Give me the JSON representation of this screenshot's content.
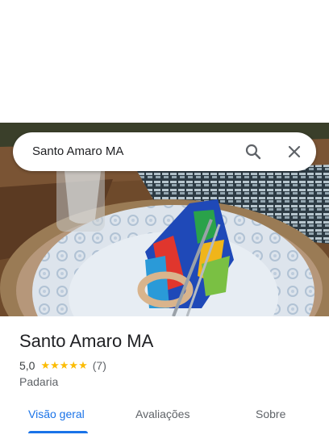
{
  "search": {
    "query": "Santo Amaro MA"
  },
  "icons": {
    "search": "search-icon",
    "close": "close-icon",
    "star": "star-icon"
  },
  "place": {
    "name": "Santo Amaro MA",
    "rating": "5,0",
    "stars": "★★★★★",
    "review_count": "(7)",
    "category": "Padaria"
  },
  "tabs": [
    {
      "label": "Visão geral",
      "active": true
    },
    {
      "label": "Avaliações",
      "active": false
    },
    {
      "label": "Sobre",
      "active": false
    }
  ],
  "colors": {
    "accent": "#1a73e8",
    "star": "#fbbc04",
    "text": "#202124",
    "muted": "#5f6368"
  }
}
